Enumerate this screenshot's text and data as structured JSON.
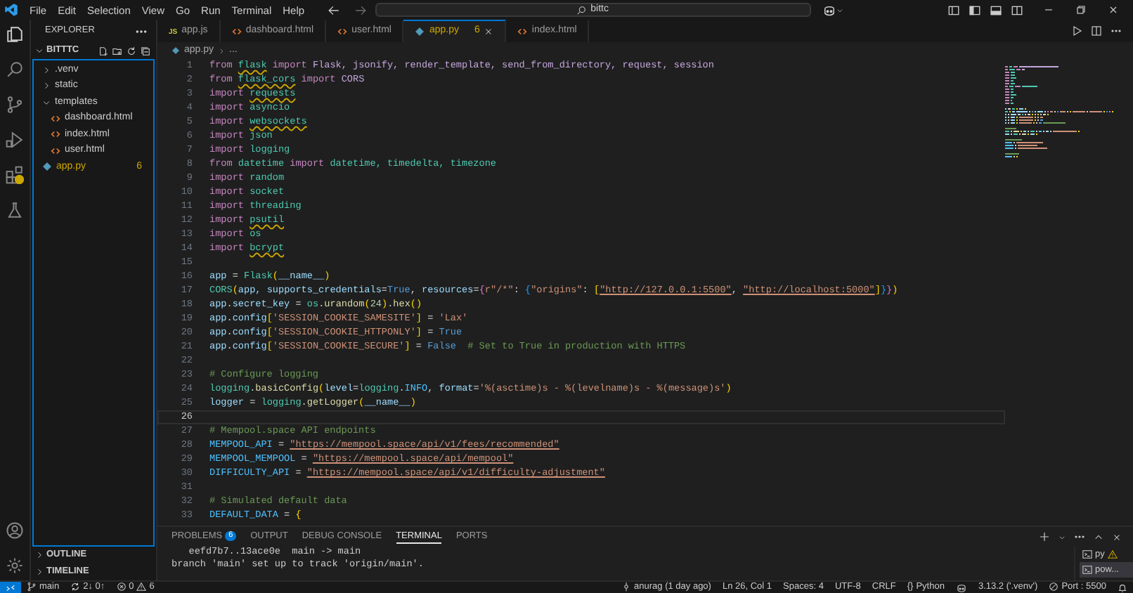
{
  "title_bar": {
    "menu": [
      "File",
      "Edit",
      "Selection",
      "View",
      "Go",
      "Run",
      "Terminal",
      "Help"
    ],
    "search": "bittc"
  },
  "sidebar": {
    "title": "EXPLORER",
    "tree": {
      "label": "BITTTC",
      "expanded": true,
      "children": [
        {
          "label": ".venv",
          "kind": "folder",
          "expanded": false
        },
        {
          "label": "static",
          "kind": "folder",
          "expanded": false
        },
        {
          "label": "templates",
          "kind": "folder",
          "expanded": true,
          "children": [
            {
              "label": "dashboard.html",
              "kind": "html",
              "warning": false
            },
            {
              "label": "index.html",
              "kind": "html",
              "warning": false
            },
            {
              "label": "user.html",
              "kind": "html",
              "warning": false
            }
          ]
        },
        {
          "label": "app.py",
          "kind": "py",
          "warning": true,
          "count": "6"
        }
      ]
    },
    "sections": [
      {
        "label": "OUTLINE",
        "expanded": false
      },
      {
        "label": "TIMELINE",
        "expanded": false
      }
    ]
  },
  "tabs": [
    {
      "label": "app.js",
      "kind": "js",
      "icon_text": "JS",
      "selected": false,
      "warning": false
    },
    {
      "label": "dashboard.html",
      "kind": "html",
      "selected": false,
      "warning": false
    },
    {
      "label": "user.html",
      "kind": "html",
      "selected": false,
      "warning": false
    },
    {
      "label": "app.py",
      "kind": "py",
      "selected": true,
      "warning": true,
      "count": "6"
    },
    {
      "label": "index.html",
      "kind": "html",
      "selected": false,
      "warning": false
    }
  ],
  "breadcrumb": [
    "app.py",
    "..."
  ],
  "editor": {
    "lines": [
      {
        "number": "1",
        "current": false,
        "tokens": [
          {
            "text": "from ",
            "kind": "kw"
          },
          {
            "text": "flask",
            "kind": "modwarn"
          },
          {
            "text": " import ",
            "kind": "kw"
          },
          {
            "text": "Flask, jsonify, render_template, send_from_directory, request, session",
            "kind": "imp"
          }
        ]
      },
      {
        "number": "2",
        "current": false,
        "tokens": [
          {
            "text": "from ",
            "kind": "kw"
          },
          {
            "text": "flask_cors",
            "kind": "modwarn"
          },
          {
            "text": " import ",
            "kind": "kw"
          },
          {
            "text": "CORS",
            "kind": "imp"
          }
        ]
      },
      {
        "number": "3",
        "current": false,
        "tokens": [
          {
            "text": "import ",
            "kind": "kw"
          },
          {
            "text": "requests",
            "kind": "modwarn"
          }
        ]
      },
      {
        "number": "4",
        "current": false,
        "tokens": [
          {
            "text": "import ",
            "kind": "kw"
          },
          {
            "text": "asyncio",
            "kind": "mod"
          }
        ]
      },
      {
        "number": "5",
        "current": false,
        "tokens": [
          {
            "text": "import ",
            "kind": "kw"
          },
          {
            "text": "websockets",
            "kind": "modwarn"
          }
        ]
      },
      {
        "number": "6",
        "current": false,
        "tokens": [
          {
            "text": "import ",
            "kind": "kw"
          },
          {
            "text": "json",
            "kind": "mod"
          }
        ]
      },
      {
        "number": "7",
        "current": false,
        "tokens": [
          {
            "text": "import ",
            "kind": "kw"
          },
          {
            "text": "logging",
            "kind": "mod"
          }
        ]
      },
      {
        "number": "8",
        "current": false,
        "tokens": [
          {
            "text": "from ",
            "kind": "kw"
          },
          {
            "text": "datetime",
            "kind": "mod"
          },
          {
            "text": " import ",
            "kind": "kw"
          },
          {
            "text": "datetime, timedelta, timezone",
            "kind": "mod"
          }
        ]
      },
      {
        "number": "9",
        "current": false,
        "tokens": [
          {
            "text": "import ",
            "kind": "kw"
          },
          {
            "text": "random",
            "kind": "mod"
          }
        ]
      },
      {
        "number": "10",
        "current": false,
        "tokens": [
          {
            "text": "import ",
            "kind": "kw"
          },
          {
            "text": "socket",
            "kind": "mod"
          }
        ]
      },
      {
        "number": "11",
        "current": false,
        "tokens": [
          {
            "text": "import ",
            "kind": "kw"
          },
          {
            "text": "threading",
            "kind": "mod"
          }
        ]
      },
      {
        "number": "12",
        "current": false,
        "tokens": [
          {
            "text": "import ",
            "kind": "kw"
          },
          {
            "text": "psutil",
            "kind": "modwarn"
          }
        ]
      },
      {
        "number": "13",
        "current": false,
        "tokens": [
          {
            "text": "import ",
            "kind": "kw"
          },
          {
            "text": "os",
            "kind": "mod"
          }
        ]
      },
      {
        "number": "14",
        "current": false,
        "tokens": [
          {
            "text": "import ",
            "kind": "kw"
          },
          {
            "text": "bcrypt",
            "kind": "modwarn"
          }
        ]
      },
      {
        "number": "15",
        "current": false
      },
      {
        "number": "16",
        "current": false,
        "tokens": [
          {
            "text": "app",
            "kind": "var"
          },
          {
            "text": " = ",
            "kind": "op"
          },
          {
            "text": "Flask",
            "kind": "cls"
          },
          {
            "text": "(",
            "kind": "b1"
          },
          {
            "text": "__name__",
            "kind": "var"
          },
          {
            "text": ")",
            "kind": "b1"
          }
        ]
      },
      {
        "number": "17",
        "current": false,
        "tokens": [
          {
            "text": "CORS",
            "kind": "cls"
          },
          {
            "text": "(",
            "kind": "b1"
          },
          {
            "text": "app, ",
            "kind": "var"
          },
          {
            "text": "supports_credentials",
            "kind": "var"
          },
          {
            "text": "=",
            "kind": "op"
          },
          {
            "text": "True",
            "kind": "const"
          },
          {
            "text": ", ",
            "kind": "op"
          },
          {
            "text": "resources",
            "kind": "var"
          },
          {
            "text": "=",
            "kind": "op"
          },
          {
            "text": "{",
            "kind": "b2"
          },
          {
            "text": "r\"/*\"",
            "kind": "str"
          },
          {
            "text": ": ",
            "kind": "op"
          },
          {
            "text": "{",
            "kind": "b3"
          },
          {
            "text": "\"origins\"",
            "kind": "str"
          },
          {
            "text": ": ",
            "kind": "op"
          },
          {
            "text": "[",
            "kind": "b1"
          },
          {
            "text": "\"http://127.0.0.1:5500\"",
            "kind": "url"
          },
          {
            "text": ", ",
            "kind": "op"
          },
          {
            "text": "\"http://localhost:5000\"",
            "kind": "url"
          },
          {
            "text": "]",
            "kind": "b1"
          },
          {
            "text": "}",
            "kind": "b3"
          },
          {
            "text": "}",
            "kind": "b2"
          },
          {
            "text": ")",
            "kind": "b1"
          }
        ]
      },
      {
        "number": "18",
        "current": false,
        "tokens": [
          {
            "text": "app",
            "kind": "var"
          },
          {
            "text": ".",
            "kind": "op"
          },
          {
            "text": "secret_key",
            "kind": "var"
          },
          {
            "text": " = ",
            "kind": "op"
          },
          {
            "text": "os",
            "kind": "mod"
          },
          {
            "text": ".",
            "kind": "op"
          },
          {
            "text": "urandom",
            "kind": "fn"
          },
          {
            "text": "(",
            "kind": "b1"
          },
          {
            "text": "24",
            "kind": "num"
          },
          {
            "text": ")",
            "kind": "b1"
          },
          {
            "text": ".",
            "kind": "op"
          },
          {
            "text": "hex",
            "kind": "fn"
          },
          {
            "text": "()",
            "kind": "b1"
          }
        ]
      },
      {
        "number": "19",
        "current": false,
        "tokens": [
          {
            "text": "app",
            "kind": "var"
          },
          {
            "text": ".",
            "kind": "op"
          },
          {
            "text": "config",
            "kind": "var"
          },
          {
            "text": "[",
            "kind": "b1"
          },
          {
            "text": "'SESSION_COOKIE_SAMESITE'",
            "kind": "str"
          },
          {
            "text": "]",
            "kind": "b1"
          },
          {
            "text": " = ",
            "kind": "op"
          },
          {
            "text": "'Lax'",
            "kind": "str"
          }
        ]
      },
      {
        "number": "20",
        "current": false,
        "tokens": [
          {
            "text": "app",
            "kind": "var"
          },
          {
            "text": ".",
            "kind": "op"
          },
          {
            "text": "config",
            "kind": "var"
          },
          {
            "text": "[",
            "kind": "b1"
          },
          {
            "text": "'SESSION_COOKIE_HTTPONLY'",
            "kind": "str"
          },
          {
            "text": "]",
            "kind": "b1"
          },
          {
            "text": " = ",
            "kind": "op"
          },
          {
            "text": "True",
            "kind": "const"
          }
        ]
      },
      {
        "number": "21",
        "current": false,
        "tokens": [
          {
            "text": "app",
            "kind": "var"
          },
          {
            "text": ".",
            "kind": "op"
          },
          {
            "text": "config",
            "kind": "var"
          },
          {
            "text": "[",
            "kind": "b1"
          },
          {
            "text": "'SESSION_COOKIE_SECURE'",
            "kind": "str"
          },
          {
            "text": "]",
            "kind": "b1"
          },
          {
            "text": " = ",
            "kind": "op"
          },
          {
            "text": "False",
            "kind": "const"
          },
          {
            "text": "  # Set to True in production with HTTPS",
            "kind": "cmt"
          }
        ]
      },
      {
        "number": "22",
        "current": false
      },
      {
        "number": "23",
        "current": false,
        "tokens": [
          {
            "text": "# Configure logging",
            "kind": "cmt"
          }
        ]
      },
      {
        "number": "24",
        "current": false,
        "tokens": [
          {
            "text": "logging",
            "kind": "mod"
          },
          {
            "text": ".",
            "kind": "op"
          },
          {
            "text": "basicConfig",
            "kind": "fn"
          },
          {
            "text": "(",
            "kind": "b1"
          },
          {
            "text": "level",
            "kind": "var"
          },
          {
            "text": "=",
            "kind": "op"
          },
          {
            "text": "logging",
            "kind": "mod"
          },
          {
            "text": ".",
            "kind": "op"
          },
          {
            "text": "INFO",
            "kind": "cst"
          },
          {
            "text": ", ",
            "kind": "op"
          },
          {
            "text": "format",
            "kind": "var"
          },
          {
            "text": "=",
            "kind": "op"
          },
          {
            "text": "'%(asctime)s - %(levelname)s - %(message)s'",
            "kind": "str"
          },
          {
            "text": ")",
            "kind": "b1"
          }
        ]
      },
      {
        "number": "25",
        "current": false,
        "tokens": [
          {
            "text": "logger",
            "kind": "var"
          },
          {
            "text": " = ",
            "kind": "op"
          },
          {
            "text": "logging",
            "kind": "mod"
          },
          {
            "text": ".",
            "kind": "op"
          },
          {
            "text": "getLogger",
            "kind": "fn"
          },
          {
            "text": "(",
            "kind": "b1"
          },
          {
            "text": "__name__",
            "kind": "var"
          },
          {
            "text": ")",
            "kind": "b1"
          }
        ]
      },
      {
        "number": "26",
        "current": true
      },
      {
        "number": "27",
        "current": false,
        "tokens": [
          {
            "text": "# Mempool.space API endpoints",
            "kind": "cmt"
          }
        ]
      },
      {
        "number": "28",
        "current": false,
        "tokens": [
          {
            "text": "MEMPOOL_API",
            "kind": "cst"
          },
          {
            "text": " = ",
            "kind": "op"
          },
          {
            "text": "\"https://mempool.space/api/v1/fees/recommended\"",
            "kind": "url"
          }
        ]
      },
      {
        "number": "29",
        "current": false,
        "tokens": [
          {
            "text": "MEMPOOL_MEMPOOL",
            "kind": "cst"
          },
          {
            "text": " = ",
            "kind": "op"
          },
          {
            "text": "\"https://mempool.space/api/mempool\"",
            "kind": "url"
          }
        ]
      },
      {
        "number": "30",
        "current": false,
        "tokens": [
          {
            "text": "DIFFICULTY_API",
            "kind": "cst"
          },
          {
            "text": " = ",
            "kind": "op"
          },
          {
            "text": "\"https://mempool.space/api/v1/difficulty-adjustment\"",
            "kind": "url"
          }
        ]
      },
      {
        "number": "31",
        "current": false
      },
      {
        "number": "32",
        "current": false,
        "tokens": [
          {
            "text": "# Simulated default data",
            "kind": "cmt"
          }
        ]
      },
      {
        "number": "33",
        "current": false,
        "tokens": [
          {
            "text": "DEFAULT_DATA",
            "kind": "cst"
          },
          {
            "text": " = ",
            "kind": "op"
          },
          {
            "text": "{",
            "kind": "b1"
          }
        ]
      }
    ]
  },
  "panel": {
    "tabs": [
      {
        "label": "PROBLEMS",
        "count": "6",
        "selected": false
      },
      {
        "label": "OUTPUT",
        "selected": false
      },
      {
        "label": "DEBUG CONSOLE",
        "selected": false
      },
      {
        "label": "TERMINAL",
        "selected": true
      },
      {
        "label": "PORTS",
        "selected": false
      }
    ],
    "terminal_lines": [
      "   eefd7b7..13ace0e  main -> main",
      "branch 'main' set up to track 'origin/main'."
    ],
    "terminals": [
      {
        "label": "py",
        "warning": true,
        "selected": false
      },
      {
        "label": "pow...",
        "warning": false,
        "selected": true
      }
    ]
  },
  "status_bar": {
    "branch": "main",
    "sync": "2↓ 0↑",
    "errors": "0",
    "warnings": "6",
    "blame": "anurag (1 day ago)",
    "position": "Ln 26, Col 1",
    "indent": "Spaces: 4",
    "encoding": "UTF-8",
    "eol": "CRLF",
    "language_icon": "{}",
    "language": "Python",
    "interpreter": "3.13.2 ('.venv')",
    "port": "Port : 5500"
  }
}
